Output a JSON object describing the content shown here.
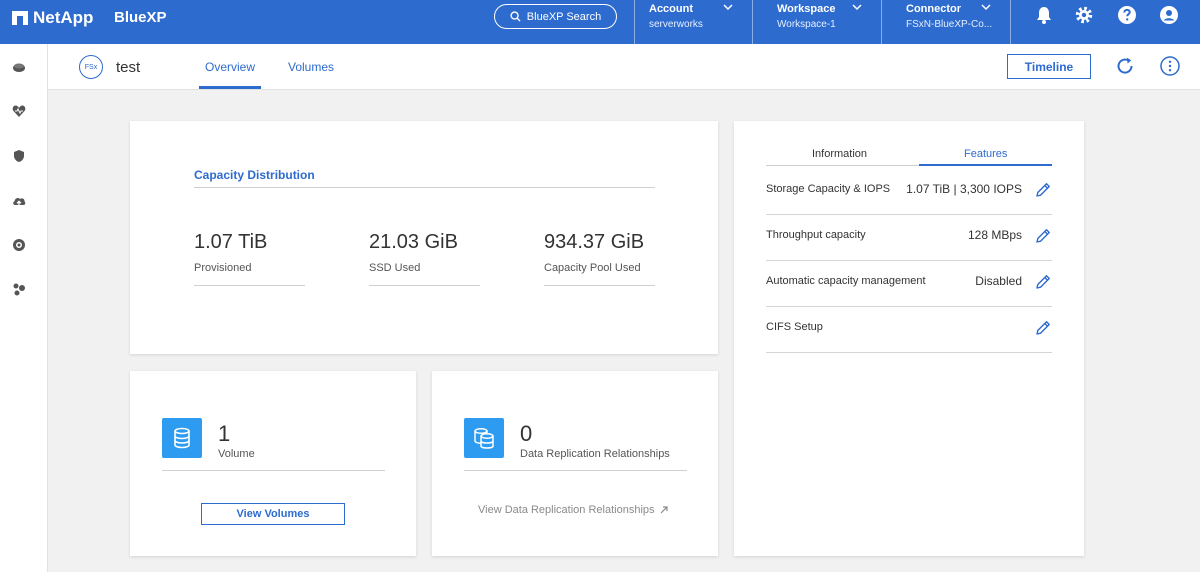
{
  "topbar": {
    "brand": "NetApp",
    "product": "BlueXP",
    "search_label": "BlueXP Search",
    "account": {
      "label": "Account",
      "value": "serverworks"
    },
    "workspace": {
      "label": "Workspace",
      "value": "Workspace-1"
    },
    "connector": {
      "label": "Connector",
      "value": "FSxN-BlueXP-Co..."
    }
  },
  "subheader": {
    "badge": "FSx",
    "name": "test",
    "tabs": [
      {
        "label": "Overview",
        "active": true
      },
      {
        "label": "Volumes",
        "active": false
      }
    ],
    "timeline_label": "Timeline"
  },
  "capacity": {
    "title": "Capacity Distribution",
    "metrics": [
      {
        "value": "1.07 TiB",
        "label": "Provisioned"
      },
      {
        "value": "21.03 GiB",
        "label": "SSD Used"
      },
      {
        "value": "934.37 GiB",
        "label": "Capacity Pool Used"
      }
    ]
  },
  "volumes_card": {
    "count": "1",
    "label": "Volume",
    "button": "View Volumes"
  },
  "replication_card": {
    "count": "0",
    "label": "Data Replication Relationships",
    "link": "View Data Replication Relationships"
  },
  "features": {
    "tabs": [
      {
        "label": "Information",
        "active": false
      },
      {
        "label": "Features",
        "active": true
      }
    ],
    "rows": [
      {
        "key": "Storage Capacity & IOPS",
        "value": "1.07 TiB | 3,300 IOPS"
      },
      {
        "key": "Throughput capacity",
        "value": "128 MBps"
      },
      {
        "key": "Automatic capacity management",
        "value": "Disabled"
      },
      {
        "key": "CIFS Setup",
        "value": ""
      }
    ]
  },
  "icons": {
    "top": [
      "search-icon",
      "chevron-down-icon",
      "bell-icon",
      "gear-icon",
      "help-icon",
      "user-icon"
    ],
    "nav": [
      "storage-icon",
      "health-icon",
      "shield-icon",
      "cloud-upload-icon",
      "governance-icon",
      "nodes-icon"
    ],
    "subheader": [
      "refresh-icon",
      "more-vertical-icon"
    ],
    "cards": [
      "database-icon",
      "replication-icon",
      "external-link-icon",
      "edit-icon"
    ]
  },
  "colors": {
    "primary": "#2d6bcf",
    "accent": "#2d9bf0",
    "background": "#f1f1f1"
  }
}
